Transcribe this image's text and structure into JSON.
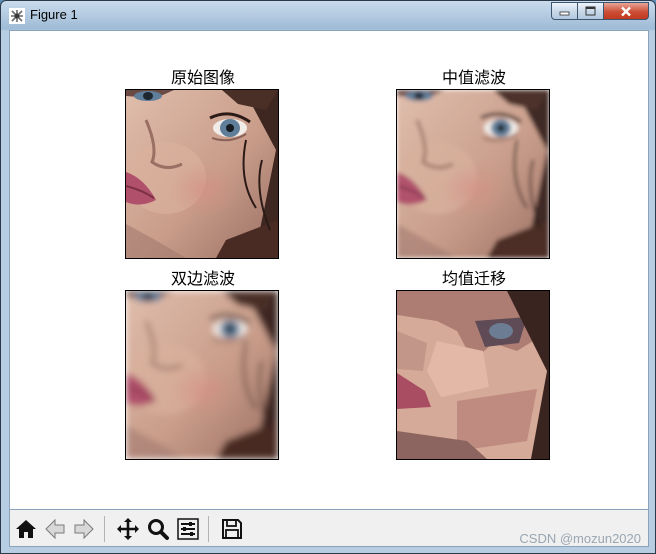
{
  "window": {
    "title": "Figure 1",
    "controls": {
      "minimize": "minimize",
      "maximize": "maximize",
      "close": "close"
    }
  },
  "figure": {
    "subplots": [
      {
        "title": "原始图像",
        "image": "portrait-original"
      },
      {
        "title": "中值滤波",
        "image": "portrait-median-filtered"
      },
      {
        "title": "双边滤波",
        "image": "portrait-bilateral-filtered"
      },
      {
        "title": "均值迁移",
        "image": "portrait-mean-shift"
      }
    ]
  },
  "toolbar": {
    "buttons": [
      {
        "name": "home-icon",
        "tooltip": "Home"
      },
      {
        "name": "back-icon",
        "tooltip": "Back"
      },
      {
        "name": "forward-icon",
        "tooltip": "Forward"
      },
      {
        "name": "pan-icon",
        "tooltip": "Pan"
      },
      {
        "name": "zoom-icon",
        "tooltip": "Zoom"
      },
      {
        "name": "configure-subplots-icon",
        "tooltip": "Configure subplots"
      },
      {
        "name": "save-icon",
        "tooltip": "Save"
      }
    ]
  },
  "watermark": "CSDN @mozun2020",
  "colors": {
    "titlebar": "#a9c4de",
    "canvas": "#ffffff",
    "toolbar": "#f0f0f0",
    "close_button": "#c8452c",
    "skin": "#caa591",
    "hair": "#3d2720",
    "lips": "#b0506a",
    "eye": "#5e7e9a"
  }
}
